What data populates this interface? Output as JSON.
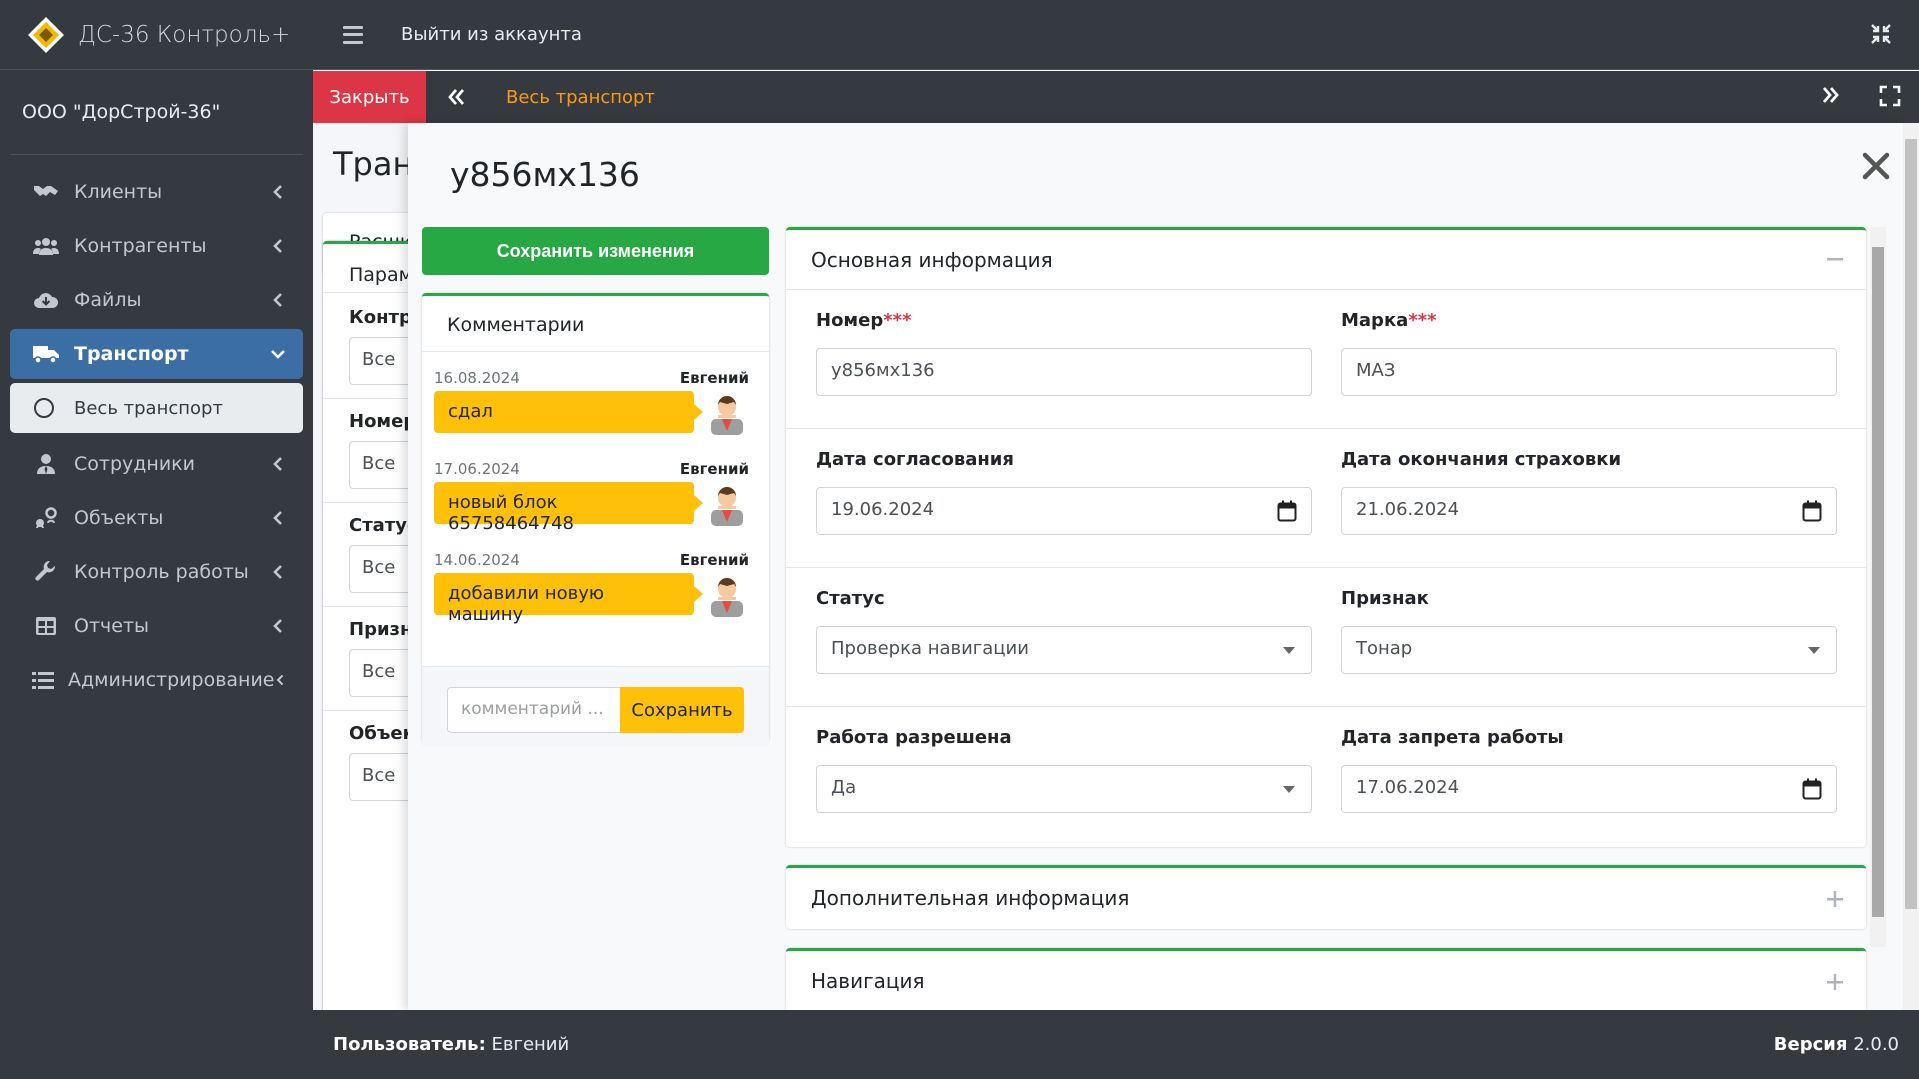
{
  "brand": {
    "title": "ДС-36 Контроль+"
  },
  "sidebar": {
    "company": "ООО \"ДорСтрой-36\"",
    "items": [
      {
        "label": "Клиенты",
        "icon": "handshake-icon"
      },
      {
        "label": "Контрагенты",
        "icon": "users-icon"
      },
      {
        "label": "Файлы",
        "icon": "cloud-download-icon"
      },
      {
        "label": "Транспорт",
        "icon": "truck-icon",
        "active": true
      },
      {
        "label": "Сотрудники",
        "icon": "user-tie-icon"
      },
      {
        "label": "Объекты",
        "icon": "map-marker-icon"
      },
      {
        "label": "Контроль работы",
        "icon": "wrench-icon"
      },
      {
        "label": "Отчеты",
        "icon": "table-icon"
      },
      {
        "label": "Администрирование",
        "icon": "list-icon"
      }
    ],
    "subitem": "Весь транспорт"
  },
  "topbar": {
    "logout": "Выйти из аккаунта"
  },
  "tabs": {
    "close": "Закрыть",
    "active_tab": "Весь транспорт"
  },
  "background": {
    "page_title": "Тран",
    "card_tab": "Расши",
    "params_header": "Парам",
    "filters": [
      {
        "label": "Контр",
        "value": "Все"
      },
      {
        "label": "Номер",
        "value": "Все"
      },
      {
        "label": "Статус",
        "value": "Все"
      },
      {
        "label": "Призна",
        "value": "Все"
      },
      {
        "label": "Объект",
        "value": "Все"
      }
    ]
  },
  "panel": {
    "title": "у856мх136",
    "save_changes": "Сохранить изменения",
    "comments": {
      "header": "Комментарии",
      "items": [
        {
          "date": "16.08.2024",
          "author": "Евгений",
          "text": "сдал"
        },
        {
          "date": "17.06.2024",
          "author": "Евгений",
          "text": "новый блок 65758464748"
        },
        {
          "date": "14.06.2024",
          "author": "Евгений",
          "text": "добавили новую машину"
        }
      ],
      "input_placeholder": "комментарий ...",
      "save": "Сохранить"
    },
    "main_info": {
      "header": "Основная информация",
      "required_mark": "***",
      "fields": {
        "number_label": "Номер",
        "number_value": "у856мх136",
        "brand_label": "Марка",
        "brand_value": "МАЗ",
        "approval_label": "Дата согласования",
        "approval_value": "19.06.2024",
        "insurance_label": "Дата окончания страховки",
        "insurance_value": "21.06.2024",
        "status_label": "Статус",
        "status_value": "Проверка навигации",
        "sign_label": "Признак",
        "sign_value": "Тонар",
        "work_allowed_label": "Работа разрешена",
        "work_allowed_value": "Да",
        "work_ban_label": "Дата запрета работы",
        "work_ban_value": "17.06.2024"
      }
    },
    "extra_info": {
      "header": "Дополнительная информация"
    },
    "navigation": {
      "header": "Навигация"
    }
  },
  "footer": {
    "user_label": "Пользователь:",
    "user_value": "Евгений",
    "version_label": "Версия",
    "version_value": "2.0.0"
  },
  "colors": {
    "accent_green": "#28a745",
    "close_red": "#dc3545",
    "warning_yellow": "#ffc107",
    "tab_orange": "#fd9a0e",
    "active_blue": "#3b6ea5",
    "sidebar_dark": "#343a40"
  }
}
